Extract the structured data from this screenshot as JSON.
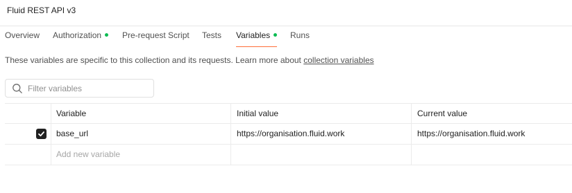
{
  "header": {
    "title": "Fluid REST API v3"
  },
  "tabs": [
    {
      "label": "Overview",
      "dot": false
    },
    {
      "label": "Authorization",
      "dot": true
    },
    {
      "label": "Pre-request Script",
      "dot": false
    },
    {
      "label": "Tests",
      "dot": false
    },
    {
      "label": "Variables",
      "dot": true,
      "active": true
    },
    {
      "label": "Runs",
      "dot": false
    }
  ],
  "description": {
    "text": "These variables are specific to this collection and its requests. Learn more about ",
    "link": "collection variables"
  },
  "filter": {
    "placeholder": "Filter variables",
    "value": ""
  },
  "table": {
    "columns": [
      "Variable",
      "Initial value",
      "Current value"
    ],
    "rows": [
      {
        "checked": true,
        "variable": "base_url",
        "initial": "https://organisation.fluid.work",
        "current": "https://organisation.fluid.work"
      }
    ],
    "new_row_placeholder": "Add new variable"
  },
  "colors": {
    "accent": "#ff6c37",
    "status_dot": "#0cbb52"
  }
}
